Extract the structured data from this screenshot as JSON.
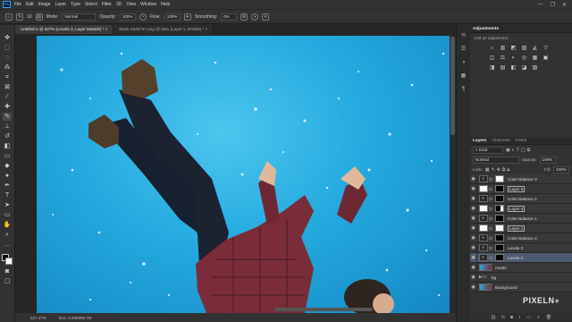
{
  "menubar": {
    "logo": "Ps",
    "items": [
      "File",
      "Edit",
      "Image",
      "Layer",
      "Type",
      "Select",
      "Filter",
      "3D",
      "View",
      "Window",
      "Help"
    ]
  },
  "options": {
    "brush_size": "10",
    "mode_label": "Mode:",
    "mode_value": "Normal",
    "opacity_label": "Opacity:",
    "opacity_value": "100%",
    "flow_label": "Flow:",
    "flow_value": "100%",
    "smoothing_label": "Smoothing:",
    "smoothing_value": "0%"
  },
  "tabs": [
    {
      "label": "Untitled-1 @ 627% (Levels 3, Layer Mask/8) *",
      "close": "×"
    },
    {
      "label": "shark-3349747.png @ 25% (Layer 1, RGB/8) *",
      "close": "×"
    }
  ],
  "status": {
    "zoom": "627.47%",
    "doc": "Doc: 5.93M/65.7M"
  },
  "panels": {
    "adjustments_tab": "Adjustments",
    "adjustments_hint": "Add an adjustment",
    "adjustment_icons": [
      "☼",
      "▥",
      "◩",
      "▨",
      "◭",
      "▽",
      "",
      "",
      "◫",
      "⚖",
      "◐",
      "◎",
      "▦",
      "▣",
      "",
      "",
      "◨",
      "▤",
      "◧",
      "◪",
      "▧",
      "",
      "",
      ""
    ],
    "layers_tabs": [
      "Layers",
      "Channels",
      "Paths"
    ],
    "kind_label": "Kind",
    "blend_mode": "Normal",
    "opacity_label": "Opacity:",
    "opacity_value": "100%",
    "lock_label": "Lock:",
    "fill_label": "Fill:",
    "fill_value": "100%"
  },
  "layers": [
    {
      "name": "Color Balance 3",
      "thumb": "adj",
      "mask": "white",
      "active": false
    },
    {
      "name": "Layer 5",
      "thumb": "mask",
      "mask": "black",
      "active": false
    },
    {
      "name": "Color Balance 2",
      "thumb": "adj",
      "mask": "black",
      "active": false
    },
    {
      "name": "Layer 4",
      "thumb": "mask",
      "mask": "mixed",
      "active": false
    },
    {
      "name": "Color Balance 1",
      "thumb": "adj",
      "mask": "black",
      "active": false
    },
    {
      "name": "Layer 2",
      "thumb": "mask",
      "mask": "white",
      "active": false
    },
    {
      "name": "Color Balance 4",
      "thumb": "adj",
      "mask": "black",
      "active": false
    },
    {
      "name": "Levels 2",
      "thumb": "adj",
      "mask": "black",
      "active": false
    },
    {
      "name": "Levels 3",
      "thumb": "adj",
      "mask": "black",
      "active": true
    },
    {
      "name": "model",
      "thumb": "photo",
      "mask": "",
      "active": false
    },
    {
      "name": "bg",
      "thumb": "folder",
      "mask": "",
      "active": false
    },
    {
      "name": "Background",
      "thumb": "photo",
      "mask": "",
      "active": false
    }
  ],
  "watermark": {
    "text": "PIXELN",
    "suffix": "●"
  }
}
